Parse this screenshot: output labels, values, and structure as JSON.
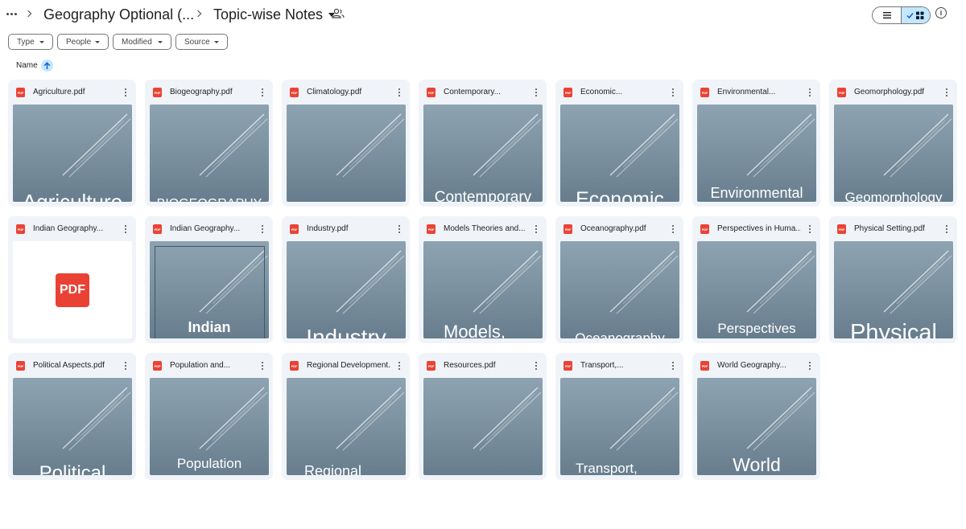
{
  "breadcrumb": {
    "parent": "Geography Optional (...",
    "current": "Topic-wise Notes"
  },
  "icons": {
    "more_nav": "more-horizontal-icon",
    "separator": "chevron-right-icon",
    "shared": "shared-folder-people-icon",
    "list_view": "list-view-icon",
    "grid_view": "grid-view-icon",
    "checkmark": "check-icon",
    "info": "info-icon"
  },
  "filters": [
    "Type",
    "People",
    "Modified",
    "Source"
  ],
  "sort": {
    "label": "Name",
    "direction": "ascending"
  },
  "file_badge": "PDF",
  "colors": {
    "accent": "#c2e7ff",
    "pdf_red": "#ea4335",
    "card_bg": "#f0f4f9",
    "cover_blue_grey": "#7d93a2"
  },
  "files": [
    {
      "name": "Agriculture.pdf",
      "cover_text": "Agriculture"
    },
    {
      "name": "Biogeography.pdf",
      "cover_text": "BIOGEOGRAPHY"
    },
    {
      "name": "Climatology.pdf",
      "cover_text": ""
    },
    {
      "name": "Contemporary...",
      "cover_text": "Contemporary"
    },
    {
      "name": "Economic...",
      "cover_text": "Economic"
    },
    {
      "name": "Environmental...",
      "cover_text": "Environmental"
    },
    {
      "name": "Geomorphology.pdf",
      "cover_text": "Geomorphology"
    },
    {
      "name": "Indian Geography...",
      "cover_text": "PDF"
    },
    {
      "name": "Indian Geography...",
      "cover_text": "Indian"
    },
    {
      "name": "Industry.pdf",
      "cover_text": "Industry"
    },
    {
      "name": "Models Theories and...",
      "cover_text": "Models,"
    },
    {
      "name": "Oceanography.pdf",
      "cover_text": "Oceanography"
    },
    {
      "name": "Perspectives in Huma...",
      "cover_text": "Perspectives"
    },
    {
      "name": "Physical Setting.pdf",
      "cover_text": "Physical"
    },
    {
      "name": "Political Aspects.pdf",
      "cover_text": "Political"
    },
    {
      "name": "Population and...",
      "cover_text": "Population"
    },
    {
      "name": "Regional Development...",
      "cover_text": "Regional"
    },
    {
      "name": "Resources.pdf",
      "cover_text": ""
    },
    {
      "name": "Transport,...",
      "cover_text": "Transport,"
    },
    {
      "name": "World Geography...",
      "cover_text": "World"
    }
  ]
}
